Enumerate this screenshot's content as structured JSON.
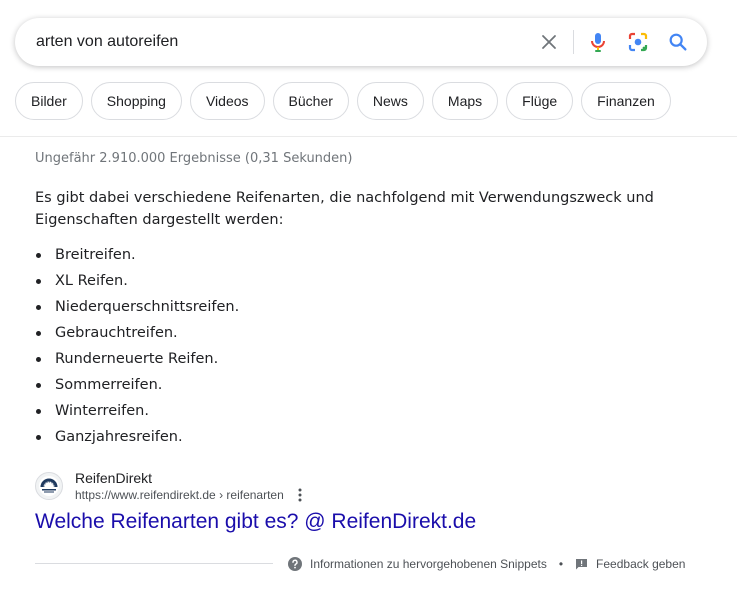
{
  "search": {
    "query": "arten von autoreifen"
  },
  "chips": [
    {
      "label": "Bilder"
    },
    {
      "label": "Shopping"
    },
    {
      "label": "Videos"
    },
    {
      "label": "Bücher"
    },
    {
      "label": "News"
    },
    {
      "label": "Maps"
    },
    {
      "label": "Flüge"
    },
    {
      "label": "Finanzen"
    }
  ],
  "results_stats": "Ungefähr 2.910.000 Ergebnisse (0,31 Sekunden)",
  "snippet": {
    "intro": "Es gibt dabei verschiedene Reifenarten, die nachfolgend mit Verwendungszweck und Eigenschaften dargestellt werden:",
    "items": [
      "Breitreifen.",
      "XL Reifen.",
      "Niederquerschnittsreifen.",
      "Gebrauchtreifen.",
      "Runderneuerte Reifen.",
      "Sommerreifen.",
      "Winterreifen.",
      "Ganzjahresreifen."
    ]
  },
  "source": {
    "site_name": "ReifenDirekt",
    "url": "https://www.reifendirekt.de › reifenarten",
    "title": "Welche Reifenarten gibt es? @ ReifenDirekt.de"
  },
  "footer": {
    "info_label": "Informationen zu hervorgehobenen Snippets",
    "separator": "•",
    "feedback_label": "Feedback geben"
  },
  "colors": {
    "link": "#1a0dab",
    "google_blue": "#4285f4",
    "google_red": "#ea4335",
    "google_yellow": "#fbbc05",
    "google_green": "#34a853"
  },
  "icons": [
    "clear-icon",
    "microphone-icon",
    "lens-icon",
    "search-icon",
    "favicon-icon",
    "more-vert-icon",
    "help-icon",
    "feedback-icon"
  ]
}
